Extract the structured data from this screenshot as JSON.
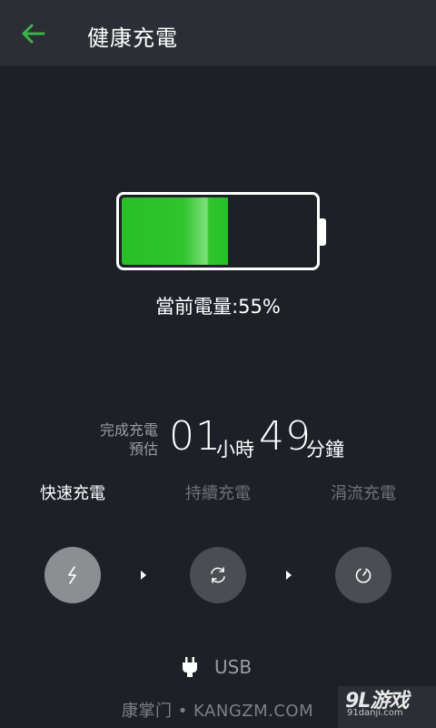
{
  "header": {
    "title": "健康充電",
    "back_icon": "arrow-left-icon",
    "accent_color": "#3ab34a"
  },
  "battery": {
    "level_percent": 55,
    "label": "當前電量:55%",
    "fill_color": "#29bf26"
  },
  "estimate": {
    "label_line1": "完成充電",
    "label_line2": "預估",
    "hours": "01",
    "hours_unit": "小時",
    "minutes": "49",
    "minutes_unit": "分鐘"
  },
  "modes": [
    {
      "label": "快速充電",
      "icon": "lightning-icon",
      "active": true
    },
    {
      "label": "持續充電",
      "icon": "refresh-icon",
      "active": false
    },
    {
      "label": "涓流充電",
      "icon": "timer-icon",
      "active": false
    }
  ],
  "source": {
    "icon": "plug-icon",
    "label": "USB"
  },
  "watermarks": {
    "left": "康掌门 • KANGZM.COM",
    "right_logo": "9L游戏",
    "right_url": "91danji.com"
  }
}
